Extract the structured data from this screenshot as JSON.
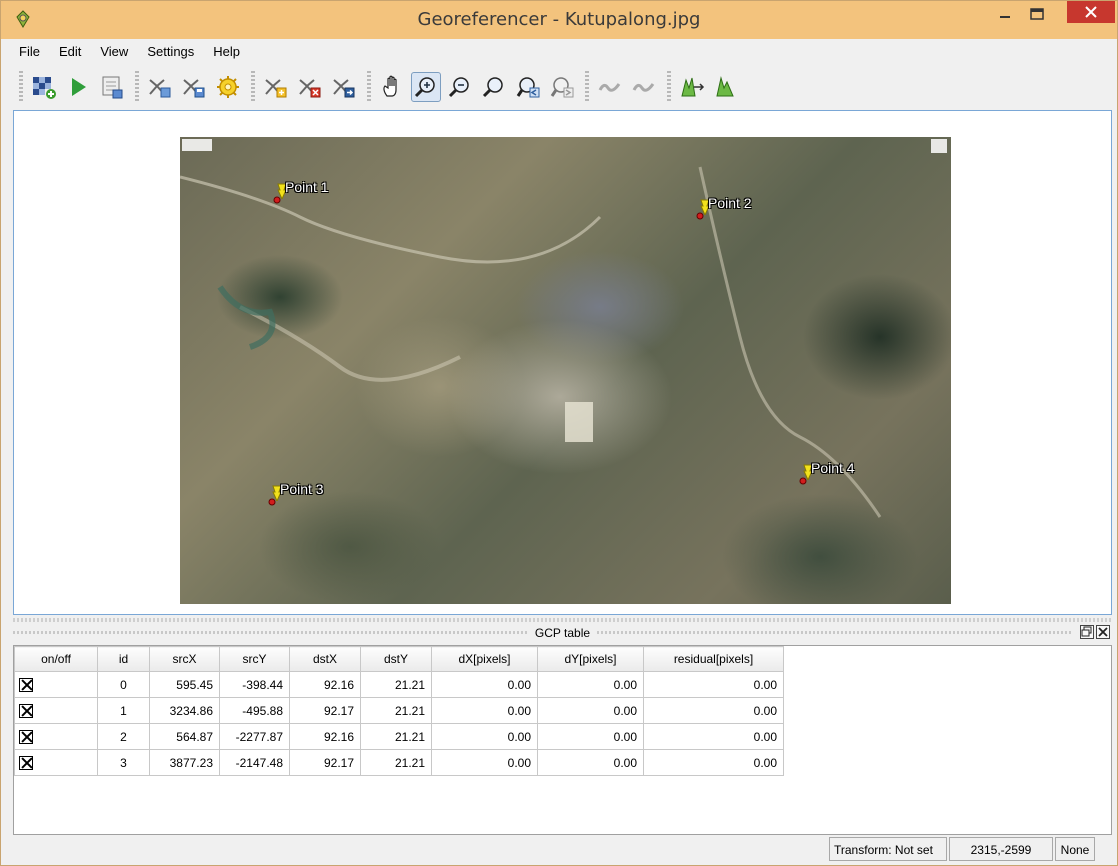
{
  "window": {
    "title": "Georeferencer - Kutupalong.jpg"
  },
  "menu": [
    "File",
    "Edit",
    "View",
    "Settings",
    "Help"
  ],
  "toolbar": {
    "icons": [
      "open-raster-icon",
      "start-georeferencing-icon",
      "generate-gdal-script-icon",
      "load-gcp-points-icon",
      "save-gcp-points-icon",
      "transformation-settings-icon",
      "add-point-icon",
      "delete-point-icon",
      "move-gcp-point-icon",
      "pan-icon",
      "zoom-in-icon",
      "zoom-out-icon",
      "zoom-to-layer-icon",
      "zoom-last-icon",
      "zoom-next-icon",
      "link-georeferencer-to-qgis-icon",
      "link-qgis-to-georeferencer-icon",
      "full-histogram-stretch-icon",
      "local-histogram-stretch-icon"
    ]
  },
  "canvas": {
    "points": [
      {
        "label": "Point 1"
      },
      {
        "label": "Point 2"
      },
      {
        "label": "Point 3"
      },
      {
        "label": "Point 4"
      }
    ]
  },
  "gcp_table": {
    "title": "GCP table",
    "columns": [
      "on/off",
      "id",
      "srcX",
      "srcY",
      "dstX",
      "dstY",
      "dX[pixels]",
      "dY[pixels]",
      "residual[pixels]"
    ],
    "rows": [
      {
        "enabled": true,
        "id": "0",
        "srcX": "595.45",
        "srcY": "-398.44",
        "dstX": "92.16",
        "dstY": "21.21",
        "dX": "0.00",
        "dY": "0.00",
        "residual": "0.00"
      },
      {
        "enabled": true,
        "id": "1",
        "srcX": "3234.86",
        "srcY": "-495.88",
        "dstX": "92.17",
        "dstY": "21.21",
        "dX": "0.00",
        "dY": "0.00",
        "residual": "0.00"
      },
      {
        "enabled": true,
        "id": "2",
        "srcX": "564.87",
        "srcY": "-2277.87",
        "dstX": "92.16",
        "dstY": "21.21",
        "dX": "0.00",
        "dY": "0.00",
        "residual": "0.00"
      },
      {
        "enabled": true,
        "id": "3",
        "srcX": "3877.23",
        "srcY": "-2147.48",
        "dstX": "92.17",
        "dstY": "21.21",
        "dX": "0.00",
        "dY": "0.00",
        "residual": "0.00"
      }
    ]
  },
  "status": {
    "transform": "Transform: Not set",
    "coords": "2315,-2599",
    "crs": "None"
  },
  "colors": {
    "titlebar": "#f3c37d",
    "close_button": "#c7372e",
    "point_label": "#ffffff",
    "point_marker": "#d21d1d"
  }
}
